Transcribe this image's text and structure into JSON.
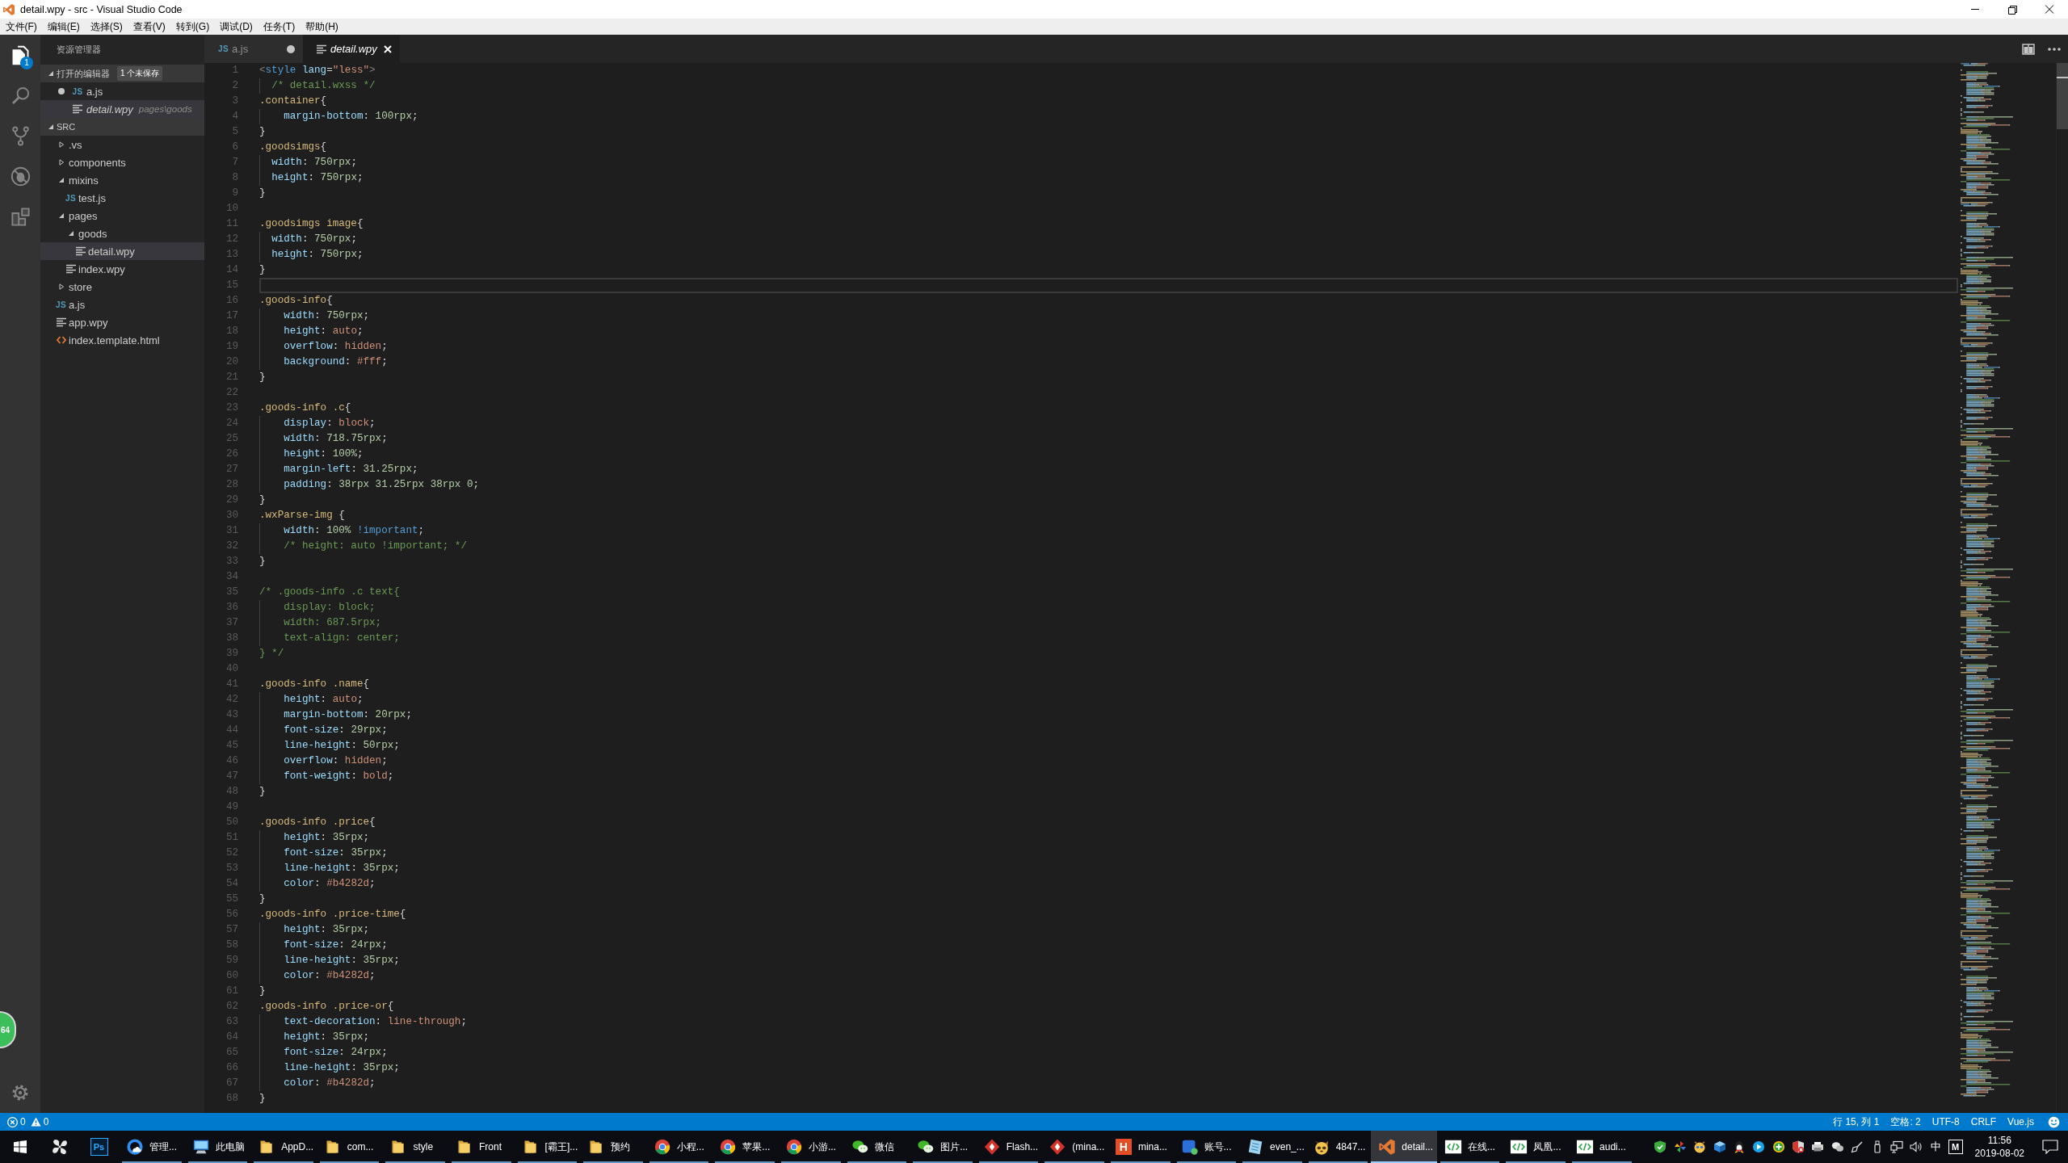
{
  "window": {
    "title": "detail.wpy - src - Visual Studio Code"
  },
  "menu": [
    "文件(F)",
    "编辑(E)",
    "选择(S)",
    "查看(V)",
    "转到(G)",
    "调试(D)",
    "任务(T)",
    "帮助(H)"
  ],
  "activity_bar": {
    "items": [
      {
        "selected": true,
        "badge": "1"
      },
      {
        "selected": false
      },
      {
        "selected": false
      },
      {
        "selected": false
      },
      {
        "selected": false
      }
    ]
  },
  "sidebar": {
    "title": "资源管理器",
    "open_editors": {
      "title": "打开的编辑器",
      "badge": "1 个未保存",
      "expanded": true,
      "files": [
        {
          "name": "a.js",
          "kind": "script",
          "icon": "JS",
          "dirty": true,
          "preview": false,
          "selected": false
        },
        {
          "name": "detail.wpy",
          "kind": "document",
          "description": "pages\\goods",
          "dirty": false,
          "preview": true,
          "selected": true
        }
      ]
    },
    "folder": {
      "title": "SRC",
      "expanded": true,
      "tree": [
        {
          "name": ".vs",
          "kind": "folder",
          "expanded": false,
          "selected": false
        },
        {
          "name": "components",
          "kind": "folder",
          "expanded": false,
          "selected": false
        },
        {
          "name": "mixins",
          "kind": "folder",
          "expanded": true,
          "selected": false,
          "children": [
            {
              "name": "test.js",
              "kind": "script",
              "icon": "JS",
              "selected": false
            }
          ]
        },
        {
          "name": "pages",
          "kind": "folder",
          "expanded": true,
          "selected": false,
          "children": [
            {
              "name": "goods",
              "kind": "folder",
              "expanded": true,
              "selected": false,
              "children": [
                {
                  "name": "detail.wpy",
                  "kind": "document",
                  "selected": true
                }
              ]
            },
            {
              "name": "index.wpy",
              "kind": "document",
              "selected": false
            }
          ]
        },
        {
          "name": "store",
          "kind": "folder",
          "expanded": false,
          "selected": false
        },
        {
          "name": "a.js",
          "kind": "script",
          "icon": "JS",
          "selected": false
        },
        {
          "name": "app.wpy",
          "kind": "document",
          "selected": false
        },
        {
          "name": "index.template.html",
          "kind": "markup",
          "selected": false
        }
      ]
    }
  },
  "editor": {
    "tabs": [
      {
        "label": "a.js",
        "kind": "script",
        "icon": "JS",
        "dirty": true,
        "preview": false,
        "selected": false
      },
      {
        "label": "detail.wpy",
        "kind": "document",
        "dirty": false,
        "preview": true,
        "selected": true
      }
    ],
    "lines": [
      {
        "number": "1",
        "current": false,
        "tokens": [
          {
            "kind": "bracket",
            "text": "<"
          },
          {
            "kind": "tag",
            "text": "style"
          },
          {
            "kind": "attribute",
            "text": " lang"
          },
          {
            "kind": "punctuation",
            "text": "="
          },
          {
            "kind": "string",
            "text": "\"less\""
          },
          {
            "kind": "bracket",
            "text": ">"
          }
        ]
      },
      {
        "number": "2",
        "current": false,
        "tokens": [
          {
            "kind": "comment",
            "text": "  /* detail.wxss */"
          }
        ]
      },
      {
        "number": "3",
        "current": false,
        "tokens": [
          {
            "kind": "selector",
            "text": ".container"
          },
          {
            "kind": "punctuation",
            "text": "{"
          }
        ]
      },
      {
        "number": "4",
        "current": false,
        "tokens": [
          {
            "kind": "property",
            "text": "    margin-bottom"
          },
          {
            "kind": "punctuation",
            "text": ": "
          },
          {
            "kind": "number",
            "text": "100rpx"
          },
          {
            "kind": "punctuation",
            "text": ";"
          }
        ]
      },
      {
        "number": "5",
        "current": false,
        "tokens": [
          {
            "kind": "punctuation",
            "text": "}"
          }
        ]
      },
      {
        "number": "6",
        "current": false,
        "tokens": [
          {
            "kind": "selector",
            "text": ".goodsimgs"
          },
          {
            "kind": "punctuation",
            "text": "{"
          }
        ]
      },
      {
        "number": "7",
        "current": false,
        "tokens": [
          {
            "kind": "property",
            "text": "  width"
          },
          {
            "kind": "punctuation",
            "text": ": "
          },
          {
            "kind": "number",
            "text": "750rpx"
          },
          {
            "kind": "punctuation",
            "text": ";"
          }
        ]
      },
      {
        "number": "8",
        "current": false,
        "tokens": [
          {
            "kind": "property",
            "text": "  height"
          },
          {
            "kind": "punctuation",
            "text": ": "
          },
          {
            "kind": "number",
            "text": "750rpx"
          },
          {
            "kind": "punctuation",
            "text": ";"
          }
        ]
      },
      {
        "number": "9",
        "current": false,
        "tokens": [
          {
            "kind": "punctuation",
            "text": "}"
          }
        ]
      },
      {
        "number": "10",
        "current": false
      },
      {
        "number": "11",
        "current": false,
        "tokens": [
          {
            "kind": "selector",
            "text": ".goodsimgs image"
          },
          {
            "kind": "punctuation",
            "text": "{"
          }
        ]
      },
      {
        "number": "12",
        "current": false,
        "tokens": [
          {
            "kind": "property",
            "text": "  width"
          },
          {
            "kind": "punctuation",
            "text": ": "
          },
          {
            "kind": "number",
            "text": "750rpx"
          },
          {
            "kind": "punctuation",
            "text": ";"
          }
        ]
      },
      {
        "number": "13",
        "current": false,
        "tokens": [
          {
            "kind": "property",
            "text": "  height"
          },
          {
            "kind": "punctuation",
            "text": ": "
          },
          {
            "kind": "number",
            "text": "750rpx"
          },
          {
            "kind": "punctuation",
            "text": ";"
          }
        ]
      },
      {
        "number": "14",
        "current": false,
        "tokens": [
          {
            "kind": "punctuation",
            "text": "}"
          }
        ]
      },
      {
        "number": "15",
        "current": true
      },
      {
        "number": "16",
        "current": false,
        "tokens": [
          {
            "kind": "selector",
            "text": ".goods-info"
          },
          {
            "kind": "punctuation",
            "text": "{"
          }
        ]
      },
      {
        "number": "17",
        "current": false,
        "tokens": [
          {
            "kind": "property",
            "text": "    width"
          },
          {
            "kind": "punctuation",
            "text": ": "
          },
          {
            "kind": "number",
            "text": "750rpx"
          },
          {
            "kind": "punctuation",
            "text": ";"
          }
        ]
      },
      {
        "number": "18",
        "current": false,
        "tokens": [
          {
            "kind": "property",
            "text": "    height"
          },
          {
            "kind": "punctuation",
            "text": ": "
          },
          {
            "kind": "keyword",
            "text": "auto"
          },
          {
            "kind": "punctuation",
            "text": ";"
          }
        ]
      },
      {
        "number": "19",
        "current": false,
        "tokens": [
          {
            "kind": "property",
            "text": "    overflow"
          },
          {
            "kind": "punctuation",
            "text": ": "
          },
          {
            "kind": "keyword",
            "text": "hidden"
          },
          {
            "kind": "punctuation",
            "text": ";"
          }
        ]
      },
      {
        "number": "20",
        "current": false,
        "tokens": [
          {
            "kind": "property",
            "text": "    background"
          },
          {
            "kind": "punctuation",
            "text": ": "
          },
          {
            "kind": "keyword",
            "text": "#fff"
          },
          {
            "kind": "punctuation",
            "text": ";"
          }
        ]
      },
      {
        "number": "21",
        "current": false,
        "tokens": [
          {
            "kind": "punctuation",
            "text": "}"
          }
        ]
      },
      {
        "number": "22",
        "current": false
      },
      {
        "number": "23",
        "current": false,
        "tokens": [
          {
            "kind": "selector",
            "text": ".goods-info .c"
          },
          {
            "kind": "punctuation",
            "text": "{"
          }
        ]
      },
      {
        "number": "24",
        "current": false,
        "tokens": [
          {
            "kind": "property",
            "text": "    display"
          },
          {
            "kind": "punctuation",
            "text": ": "
          },
          {
            "kind": "keyword",
            "text": "block"
          },
          {
            "kind": "punctuation",
            "text": ";"
          }
        ]
      },
      {
        "number": "25",
        "current": false,
        "tokens": [
          {
            "kind": "property",
            "text": "    width"
          },
          {
            "kind": "punctuation",
            "text": ": "
          },
          {
            "kind": "number",
            "text": "718.75rpx"
          },
          {
            "kind": "punctuation",
            "text": ";"
          }
        ]
      },
      {
        "number": "26",
        "current": false,
        "tokens": [
          {
            "kind": "property",
            "text": "    height"
          },
          {
            "kind": "punctuation",
            "text": ": "
          },
          {
            "kind": "number",
            "text": "100%"
          },
          {
            "kind": "punctuation",
            "text": ";"
          }
        ]
      },
      {
        "number": "27",
        "current": false,
        "tokens": [
          {
            "kind": "property",
            "text": "    margin-left"
          },
          {
            "kind": "punctuation",
            "text": ": "
          },
          {
            "kind": "number",
            "text": "31.25rpx"
          },
          {
            "kind": "punctuation",
            "text": ";"
          }
        ]
      },
      {
        "number": "28",
        "current": false,
        "tokens": [
          {
            "kind": "property",
            "text": "    padding"
          },
          {
            "kind": "punctuation",
            "text": ": "
          },
          {
            "kind": "number",
            "text": "38rpx 31.25rpx 38rpx 0"
          },
          {
            "kind": "punctuation",
            "text": ";"
          }
        ]
      },
      {
        "number": "29",
        "current": false,
        "tokens": [
          {
            "kind": "punctuation",
            "text": "}"
          }
        ]
      },
      {
        "number": "30",
        "current": false,
        "tokens": [
          {
            "kind": "selector",
            "text": ".wxParse-img"
          },
          {
            "kind": "punctuation",
            "text": " {"
          }
        ]
      },
      {
        "number": "31",
        "current": false,
        "tokens": [
          {
            "kind": "property",
            "text": "    width"
          },
          {
            "kind": "punctuation",
            "text": ": "
          },
          {
            "kind": "number",
            "text": "100%"
          },
          {
            "kind": "important",
            "text": " !important"
          },
          {
            "kind": "punctuation",
            "text": ";"
          }
        ]
      },
      {
        "number": "32",
        "current": false,
        "tokens": [
          {
            "kind": "comment",
            "text": "    /* height: auto !important; */"
          }
        ]
      },
      {
        "number": "33",
        "current": false,
        "tokens": [
          {
            "kind": "punctuation",
            "text": "}"
          }
        ]
      },
      {
        "number": "34",
        "current": false
      },
      {
        "number": "35",
        "current": false,
        "tokens": [
          {
            "kind": "comment",
            "text": "/* .goods-info .c text{"
          }
        ]
      },
      {
        "number": "36",
        "current": false,
        "tokens": [
          {
            "kind": "comment",
            "text": "    display: block;"
          }
        ]
      },
      {
        "number": "37",
        "current": false,
        "tokens": [
          {
            "kind": "comment",
            "text": "    width: 687.5rpx;"
          }
        ]
      },
      {
        "number": "38",
        "current": false,
        "tokens": [
          {
            "kind": "comment",
            "text": "    text-align: center;"
          }
        ]
      },
      {
        "number": "39",
        "current": false,
        "tokens": [
          {
            "kind": "comment",
            "text": "} */"
          }
        ]
      },
      {
        "number": "40",
        "current": false
      },
      {
        "number": "41",
        "current": false,
        "tokens": [
          {
            "kind": "selector",
            "text": ".goods-info .name"
          },
          {
            "kind": "punctuation",
            "text": "{"
          }
        ]
      },
      {
        "number": "42",
        "current": false,
        "tokens": [
          {
            "kind": "property",
            "text": "    height"
          },
          {
            "kind": "punctuation",
            "text": ": "
          },
          {
            "kind": "keyword",
            "text": "auto"
          },
          {
            "kind": "punctuation",
            "text": ";"
          }
        ]
      },
      {
        "number": "43",
        "current": false,
        "tokens": [
          {
            "kind": "property",
            "text": "    margin-bottom"
          },
          {
            "kind": "punctuation",
            "text": ": "
          },
          {
            "kind": "number",
            "text": "20rpx"
          },
          {
            "kind": "punctuation",
            "text": ";"
          }
        ]
      },
      {
        "number": "44",
        "current": false,
        "tokens": [
          {
            "kind": "property",
            "text": "    font-size"
          },
          {
            "kind": "punctuation",
            "text": ": "
          },
          {
            "kind": "number",
            "text": "29rpx"
          },
          {
            "kind": "punctuation",
            "text": ";"
          }
        ]
      },
      {
        "number": "45",
        "current": false,
        "tokens": [
          {
            "kind": "property",
            "text": "    line-height"
          },
          {
            "kind": "punctuation",
            "text": ": "
          },
          {
            "kind": "number",
            "text": "50rpx"
          },
          {
            "kind": "punctuation",
            "text": ";"
          }
        ]
      },
      {
        "number": "46",
        "current": false,
        "tokens": [
          {
            "kind": "property",
            "text": "    overflow"
          },
          {
            "kind": "punctuation",
            "text": ": "
          },
          {
            "kind": "keyword",
            "text": "hidden"
          },
          {
            "kind": "punctuation",
            "text": ";"
          }
        ]
      },
      {
        "number": "47",
        "current": false,
        "tokens": [
          {
            "kind": "property",
            "text": "    font-weight"
          },
          {
            "kind": "punctuation",
            "text": ": "
          },
          {
            "kind": "keyword",
            "text": "bold"
          },
          {
            "kind": "punctuation",
            "text": ";"
          }
        ]
      },
      {
        "number": "48",
        "current": false,
        "tokens": [
          {
            "kind": "punctuation",
            "text": "}"
          }
        ]
      },
      {
        "number": "49",
        "current": false
      },
      {
        "number": "50",
        "current": false,
        "tokens": [
          {
            "kind": "selector",
            "text": ".goods-info .price"
          },
          {
            "kind": "punctuation",
            "text": "{"
          }
        ]
      },
      {
        "number": "51",
        "current": false,
        "tokens": [
          {
            "kind": "property",
            "text": "    height"
          },
          {
            "kind": "punctuation",
            "text": ": "
          },
          {
            "kind": "number",
            "text": "35rpx"
          },
          {
            "kind": "punctuation",
            "text": ";"
          }
        ]
      },
      {
        "number": "52",
        "current": false,
        "tokens": [
          {
            "kind": "property",
            "text": "    font-size"
          },
          {
            "kind": "punctuation",
            "text": ": "
          },
          {
            "kind": "number",
            "text": "35rpx"
          },
          {
            "kind": "punctuation",
            "text": ";"
          }
        ]
      },
      {
        "number": "53",
        "current": false,
        "tokens": [
          {
            "kind": "property",
            "text": "    line-height"
          },
          {
            "kind": "punctuation",
            "text": ": "
          },
          {
            "kind": "number",
            "text": "35rpx"
          },
          {
            "kind": "punctuation",
            "text": ";"
          }
        ]
      },
      {
        "number": "54",
        "current": false,
        "tokens": [
          {
            "kind": "property",
            "text": "    color"
          },
          {
            "kind": "punctuation",
            "text": ": "
          },
          {
            "kind": "keyword",
            "text": "#b4282d"
          },
          {
            "kind": "punctuation",
            "text": ";"
          }
        ]
      },
      {
        "number": "55",
        "current": false,
        "tokens": [
          {
            "kind": "punctuation",
            "text": "}"
          }
        ]
      },
      {
        "number": "56",
        "current": false,
        "tokens": [
          {
            "kind": "selector",
            "text": ".goods-info .price-time"
          },
          {
            "kind": "punctuation",
            "text": "{"
          }
        ]
      },
      {
        "number": "57",
        "current": false,
        "tokens": [
          {
            "kind": "property",
            "text": "    height"
          },
          {
            "kind": "punctuation",
            "text": ": "
          },
          {
            "kind": "number",
            "text": "35rpx"
          },
          {
            "kind": "punctuation",
            "text": ";"
          }
        ]
      },
      {
        "number": "58",
        "current": false,
        "tokens": [
          {
            "kind": "property",
            "text": "    font-size"
          },
          {
            "kind": "punctuation",
            "text": ": "
          },
          {
            "kind": "number",
            "text": "24rpx"
          },
          {
            "kind": "punctuation",
            "text": ";"
          }
        ]
      },
      {
        "number": "59",
        "current": false,
        "tokens": [
          {
            "kind": "property",
            "text": "    line-height"
          },
          {
            "kind": "punctuation",
            "text": ": "
          },
          {
            "kind": "number",
            "text": "35rpx"
          },
          {
            "kind": "punctuation",
            "text": ";"
          }
        ]
      },
      {
        "number": "60",
        "current": false,
        "tokens": [
          {
            "kind": "property",
            "text": "    color"
          },
          {
            "kind": "punctuation",
            "text": ": "
          },
          {
            "kind": "keyword",
            "text": "#b4282d"
          },
          {
            "kind": "punctuation",
            "text": ";"
          }
        ]
      },
      {
        "number": "61",
        "current": false,
        "tokens": [
          {
            "kind": "punctuation",
            "text": "}"
          }
        ]
      },
      {
        "number": "62",
        "current": false,
        "tokens": [
          {
            "kind": "selector",
            "text": ".goods-info .price-or"
          },
          {
            "kind": "punctuation",
            "text": "{"
          }
        ]
      },
      {
        "number": "63",
        "current": false,
        "tokens": [
          {
            "kind": "property",
            "text": "    text-decoration"
          },
          {
            "kind": "punctuation",
            "text": ": "
          },
          {
            "kind": "keyword",
            "text": "line-through"
          },
          {
            "kind": "punctuation",
            "text": ";"
          }
        ]
      },
      {
        "number": "64",
        "current": false,
        "tokens": [
          {
            "kind": "property",
            "text": "    height"
          },
          {
            "kind": "punctuation",
            "text": ": "
          },
          {
            "kind": "number",
            "text": "35rpx"
          },
          {
            "kind": "punctuation",
            "text": ";"
          }
        ]
      },
      {
        "number": "65",
        "current": false,
        "tokens": [
          {
            "kind": "property",
            "text": "    font-size"
          },
          {
            "kind": "punctuation",
            "text": ": "
          },
          {
            "kind": "number",
            "text": "24rpx"
          },
          {
            "kind": "punctuation",
            "text": ";"
          }
        ]
      },
      {
        "number": "66",
        "current": false,
        "tokens": [
          {
            "kind": "property",
            "text": "    line-height"
          },
          {
            "kind": "punctuation",
            "text": ": "
          },
          {
            "kind": "number",
            "text": "35rpx"
          },
          {
            "kind": "punctuation",
            "text": ";"
          }
        ]
      },
      {
        "number": "67",
        "current": false,
        "tokens": [
          {
            "kind": "property",
            "text": "    color"
          },
          {
            "kind": "punctuation",
            "text": ": "
          },
          {
            "kind": "keyword",
            "text": "#b4282d"
          },
          {
            "kind": "punctuation",
            "text": ";"
          }
        ]
      },
      {
        "number": "68",
        "current": false,
        "tokens": [
          {
            "kind": "punctuation",
            "text": "}"
          }
        ]
      }
    ]
  },
  "floating_ball": {
    "text": "64"
  },
  "status_bar": {
    "errors": "0",
    "warnings": "0",
    "items": [
      "行 15, 列 1",
      "空格: 2",
      "UTF-8",
      "CRLF",
      "Vue.js"
    ]
  },
  "taskbar": {
    "pinned_tile": "Ps",
    "apps": [
      {
        "label": "管理...",
        "selected": false
      },
      {
        "label": "此电脑",
        "selected": false
      },
      {
        "label": "AppD...",
        "selected": false
      },
      {
        "label": "com...",
        "selected": false
      },
      {
        "label": "style",
        "selected": false
      },
      {
        "label": "Front",
        "selected": false
      },
      {
        "label": "[霸王]...",
        "selected": false
      },
      {
        "label": "预约",
        "selected": false
      },
      {
        "label": "小程...",
        "selected": false
      },
      {
        "label": "苹果...",
        "selected": false
      },
      {
        "label": "小游...",
        "selected": false
      },
      {
        "label": "微信",
        "selected": false
      },
      {
        "label": "图片...",
        "selected": false
      },
      {
        "label": "Flash...",
        "selected": false
      },
      {
        "label": "(mina...",
        "selected": false
      },
      {
        "label": "mina...",
        "icon": "H",
        "selected": false
      },
      {
        "label": "账号...",
        "selected": false
      },
      {
        "label": "even_...",
        "selected": false
      },
      {
        "label": "4847...",
        "selected": false
      },
      {
        "label": "detail...",
        "selected": true
      },
      {
        "label": "在线...",
        "selected": false
      },
      {
        "label": "凤凰...",
        "selected": false
      },
      {
        "label": "audi...",
        "selected": false
      }
    ],
    "ime": "中",
    "tray_tile": "M",
    "clock": {
      "time": "11:56",
      "date": "2019-08-02"
    }
  }
}
